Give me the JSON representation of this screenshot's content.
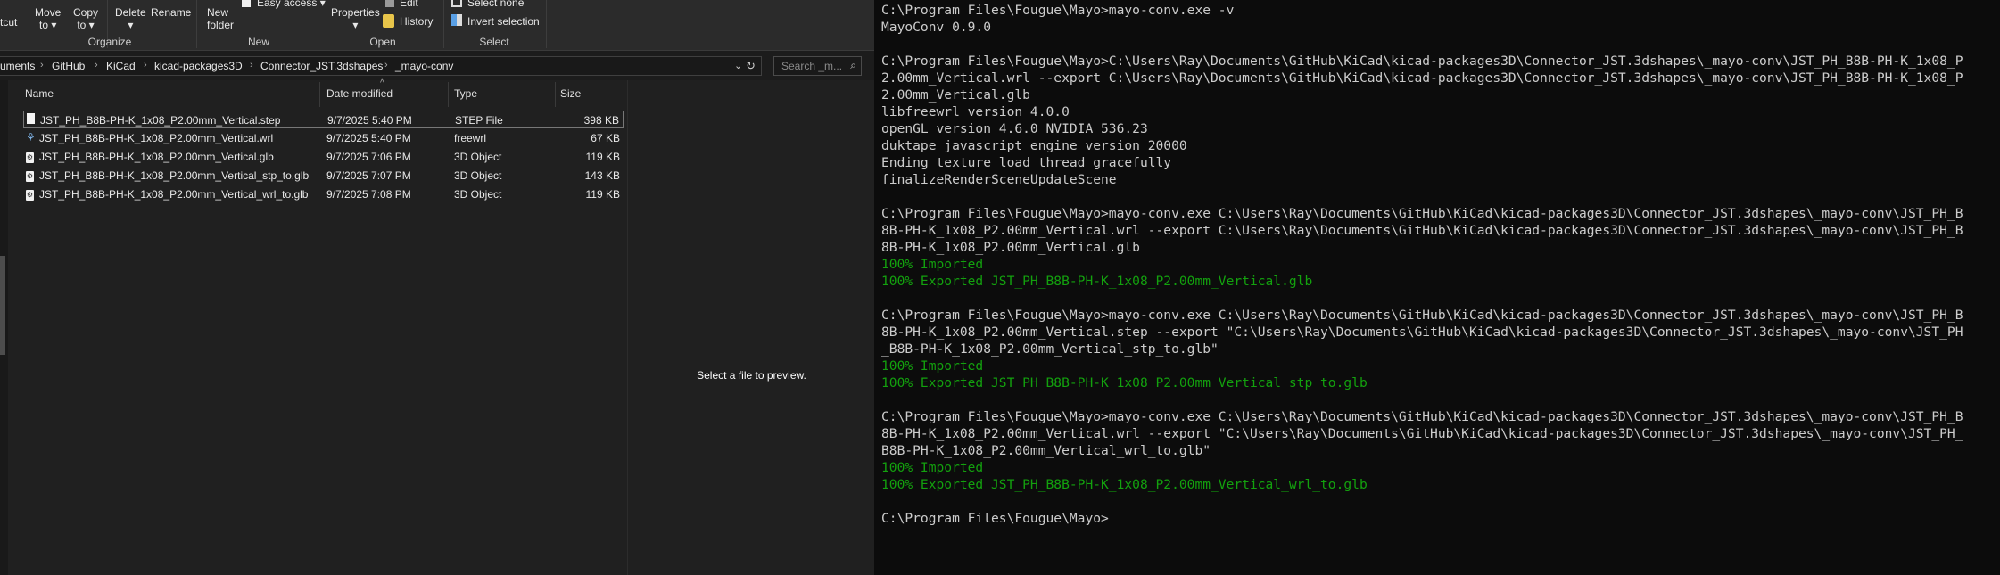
{
  "explorer": {
    "ribbon": {
      "cut": "tcut",
      "move_to": [
        "Move",
        "to ▾"
      ],
      "copy_to": [
        "Copy",
        "to ▾"
      ],
      "delete": "Delete",
      "delete_arrow": "▾",
      "rename": "Rename",
      "new_folder": [
        "New",
        "folder"
      ],
      "easy_access": "Easy access ▾",
      "properties": "Properties",
      "properties_arrow": "▾",
      "edit": "Edit",
      "history": "History",
      "select_none": "Select none",
      "invert_selection": "Invert selection",
      "groups": {
        "organize": "Organize",
        "new": "New",
        "open": "Open",
        "select": "Select"
      }
    },
    "breadcrumb": [
      "uments",
      "GitHub",
      "KiCad",
      "kicad-packages3D",
      "Connector_JST.3dshapes",
      "_mayo-conv"
    ],
    "search_placeholder": "Search _m...",
    "columns": {
      "name": "Name",
      "date": "Date modified",
      "type": "Type",
      "size": "Size"
    },
    "files": [
      {
        "name": "JST_PH_B8B-PH-K_1x08_P2.00mm_Vertical.step",
        "date": "9/7/2025 5:40 PM",
        "type": "STEP File",
        "size": "398 KB",
        "icon": "file-icon",
        "selected": true
      },
      {
        "name": "JST_PH_B8B-PH-K_1x08_P2.00mm_Vertical.wrl",
        "date": "9/7/2025 5:40 PM",
        "type": "freewrl",
        "size": "67 KB",
        "icon": "freewrl-icon",
        "selected": false
      },
      {
        "name": "JST_PH_B8B-PH-K_1x08_P2.00mm_Vertical.glb",
        "date": "9/7/2025 7:06 PM",
        "type": "3D Object",
        "size": "119 KB",
        "icon": "3d-object-icon",
        "selected": false
      },
      {
        "name": "JST_PH_B8B-PH-K_1x08_P2.00mm_Vertical_stp_to.glb",
        "date": "9/7/2025 7:07 PM",
        "type": "3D Object",
        "size": "143 KB",
        "icon": "3d-object-icon",
        "selected": false
      },
      {
        "name": "JST_PH_B8B-PH-K_1x08_P2.00mm_Vertical_wrl_to.glb",
        "date": "9/7/2025 7:08 PM",
        "type": "3D Object",
        "size": "119 KB",
        "icon": "3d-object-icon",
        "selected": false
      }
    ],
    "preview_text": "Select a file to preview."
  },
  "terminal": {
    "colors": {
      "text": "#cccccc",
      "success": "#13a10e",
      "background": "#0c0c0c"
    },
    "lines": [
      {
        "t": "C:\\Program Files\\Fougue\\Mayo>mayo-conv.exe -v"
      },
      {
        "t": "MayoConv 0.9.0"
      },
      {
        "t": ""
      },
      {
        "t": "C:\\Program Files\\Fougue\\Mayo>C:\\Users\\Ray\\Documents\\GitHub\\KiCad\\kicad-packages3D\\Connector_JST.3dshapes\\_mayo-conv\\JST_PH_B8B-PH-K_1x08_P"
      },
      {
        "t": "2.00mm_Vertical.wrl --export C:\\Users\\Ray\\Documents\\GitHub\\KiCad\\kicad-packages3D\\Connector_JST.3dshapes\\_mayo-conv\\JST_PH_B8B-PH-K_1x08_P"
      },
      {
        "t": "2.00mm_Vertical.glb"
      },
      {
        "t": "libfreewrl version 4.0.0"
      },
      {
        "t": "openGL version 4.6.0 NVIDIA 536.23"
      },
      {
        "t": "duktape javascript engine version 20000"
      },
      {
        "t": "Ending texture load thread gracefully"
      },
      {
        "t": "finalizeRenderSceneUpdateScene"
      },
      {
        "t": ""
      },
      {
        "t": "C:\\Program Files\\Fougue\\Mayo>mayo-conv.exe C:\\Users\\Ray\\Documents\\GitHub\\KiCad\\kicad-packages3D\\Connector_JST.3dshapes\\_mayo-conv\\JST_PH_B"
      },
      {
        "t": "8B-PH-K_1x08_P2.00mm_Vertical.wrl --export C:\\Users\\Ray\\Documents\\GitHub\\KiCad\\kicad-packages3D\\Connector_JST.3dshapes\\_mayo-conv\\JST_PH_B"
      },
      {
        "t": "8B-PH-K_1x08_P2.00mm_Vertical.glb"
      },
      {
        "t": "100% Imported",
        "green": true
      },
      {
        "t": "100% Exported JST_PH_B8B-PH-K_1x08_P2.00mm_Vertical.glb",
        "green": true
      },
      {
        "t": ""
      },
      {
        "t": "C:\\Program Files\\Fougue\\Mayo>mayo-conv.exe C:\\Users\\Ray\\Documents\\GitHub\\KiCad\\kicad-packages3D\\Connector_JST.3dshapes\\_mayo-conv\\JST_PH_B"
      },
      {
        "t": "8B-PH-K_1x08_P2.00mm_Vertical.step --export \"C:\\Users\\Ray\\Documents\\GitHub\\KiCad\\kicad-packages3D\\Connector_JST.3dshapes\\_mayo-conv\\JST_PH"
      },
      {
        "t": "_B8B-PH-K_1x08_P2.00mm_Vertical_stp_to.glb\""
      },
      {
        "t": "100% Imported",
        "green": true
      },
      {
        "t": "100% Exported JST_PH_B8B-PH-K_1x08_P2.00mm_Vertical_stp_to.glb",
        "green": true
      },
      {
        "t": ""
      },
      {
        "t": "C:\\Program Files\\Fougue\\Mayo>mayo-conv.exe C:\\Users\\Ray\\Documents\\GitHub\\KiCad\\kicad-packages3D\\Connector_JST.3dshapes\\_mayo-conv\\JST_PH_B"
      },
      {
        "t": "8B-PH-K_1x08_P2.00mm_Vertical.wrl --export \"C:\\Users\\Ray\\Documents\\GitHub\\KiCad\\kicad-packages3D\\Connector_JST.3dshapes\\_mayo-conv\\JST_PH_"
      },
      {
        "t": "B8B-PH-K_1x08_P2.00mm_Vertical_wrl_to.glb\""
      },
      {
        "t": "100% Imported",
        "green": true
      },
      {
        "t": "100% Exported JST_PH_B8B-PH-K_1x08_P2.00mm_Vertical_wrl_to.glb",
        "green": true
      },
      {
        "t": ""
      },
      {
        "t": "C:\\Program Files\\Fougue\\Mayo>"
      }
    ]
  }
}
